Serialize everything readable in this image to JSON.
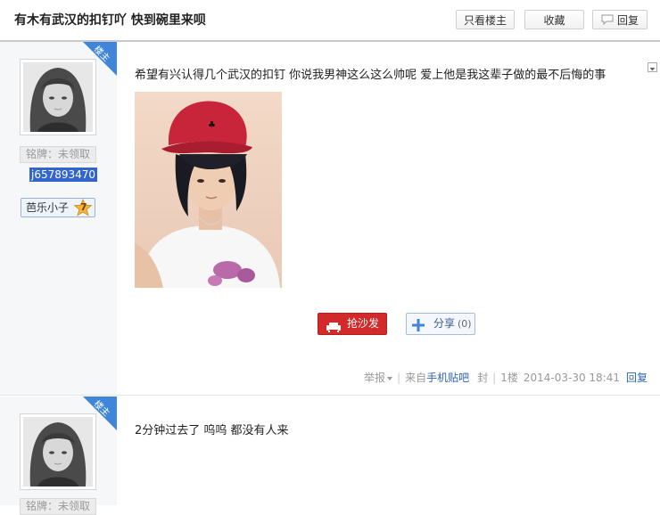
{
  "header": {
    "title": "有木有武汉的扣钉吖 快到碗里来呗",
    "only_lz_label": "只看楼主",
    "favorite_label": "收藏",
    "reply_label": "回复"
  },
  "posts": [
    {
      "badge": "楼主",
      "medal": "铭牌：未领取",
      "username": "j657893470",
      "level_name": "芭乐小子",
      "level_num": "7",
      "content": "希望有兴认得几个武汉的扣钉 你说我男神这么这么帅呢 爱上他是我这辈子做的最不后悔的事",
      "sofa_label": "抢沙发",
      "share_label": "分享",
      "share_count": "(0)",
      "meta": {
        "report": "举报",
        "from_prefix": "来自",
        "from_source": "手机贴吧",
        "seal": "封",
        "floor": "1楼",
        "time": "2014-03-30 18:41",
        "reply": "回复"
      }
    },
    {
      "badge": "楼主",
      "medal": "铭牌：未领取",
      "content": "2分钟过去了 呜呜 都没有人来"
    }
  ],
  "colors": {
    "accent_blue": "#3f86d8",
    "sofa_red": "#d22a2a",
    "link_blue": "#2d64b3",
    "sidebar_bg": "#f6f7f9"
  },
  "icons": {
    "reply": "speech-bubble-icon",
    "sofa": "sofa-icon",
    "share": "plus-icon",
    "expand": "chevron-down-icon",
    "level": "star-icon"
  }
}
